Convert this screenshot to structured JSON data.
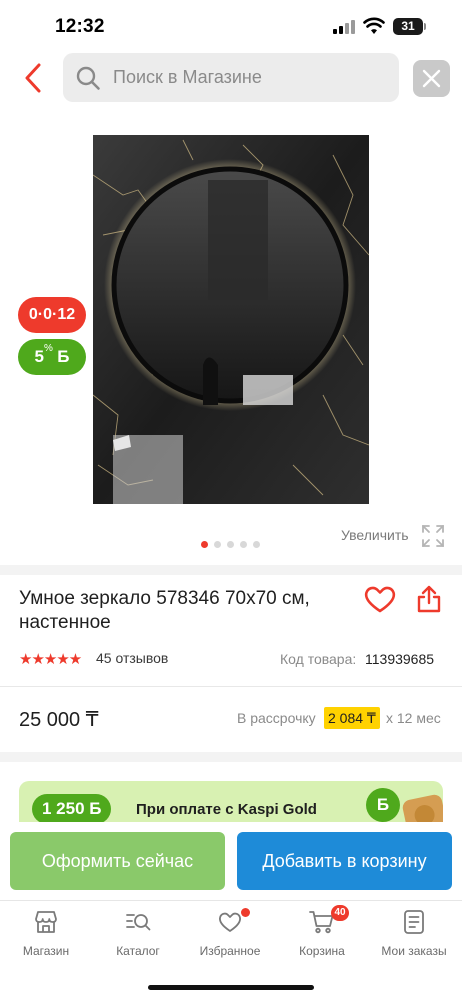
{
  "status_bar": {
    "time": "12:32",
    "battery": "31"
  },
  "header": {
    "search_placeholder": "Поиск в Магазине",
    "icons": [
      "back-chevron-icon",
      "search-icon",
      "close-icon"
    ],
    "accent_color": "#ee3a2c"
  },
  "gallery": {
    "installment_badge": "0·0·12",
    "bonus_badge": {
      "percent": "5",
      "percent_sign": "%",
      "currency": "Б"
    },
    "zoom_label": "Увеличить",
    "slide_count": 5,
    "active_slide": 1
  },
  "product": {
    "title": "Умное зеркало 578346 70x70 см, настенное",
    "rating_stars": "★★★★★",
    "rating": 4.5,
    "reviews": "45 отзывов",
    "code_label": "Код товара:",
    "code": "113939685"
  },
  "price": {
    "amount": "25 000 ₸",
    "installment_label": "В рассрочку",
    "installment_amount": "2 084 ₸",
    "installment_term": "x 12 мес"
  },
  "kaspi_gold": {
    "bonus": "1 250 Б",
    "text": "При оплате с Kaspi Gold",
    "coin": "Б"
  },
  "actions": {
    "checkout": "Оформить сейчас",
    "add_to_cart": "Добавить в корзину",
    "checkout_color": "#8ac96a",
    "cart_color": "#1e8bd8"
  },
  "tabs": [
    {
      "label": "Магазин",
      "icon": "store-icon"
    },
    {
      "label": "Каталог",
      "icon": "catalog-search-icon"
    },
    {
      "label": "Избранное",
      "icon": "heart-icon"
    },
    {
      "label": "Корзина",
      "icon": "cart-icon",
      "badge": "40"
    },
    {
      "label": "Мои заказы",
      "icon": "orders-icon"
    }
  ]
}
